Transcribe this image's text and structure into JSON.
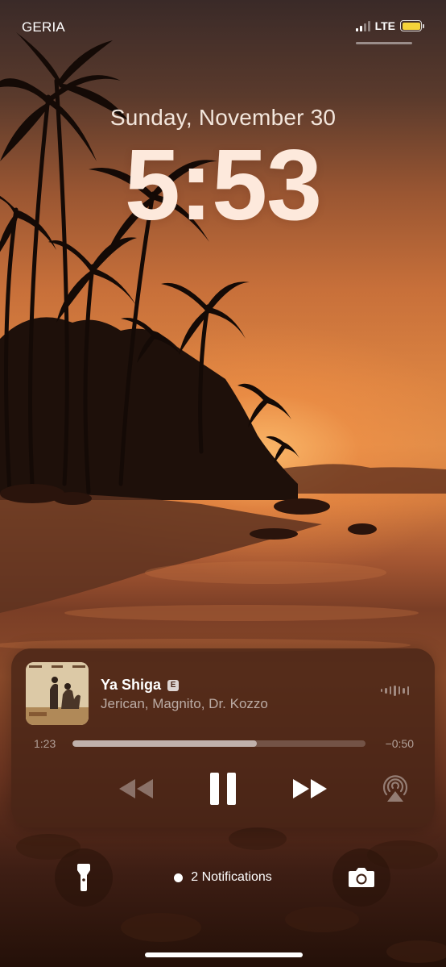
{
  "status_bar": {
    "carrier": "GERIA",
    "network": "LTE",
    "signal_bars_active": 2,
    "signal_bars_total": 4,
    "battery_color": "#f5d33a"
  },
  "lock_screen": {
    "date": "Sunday, November 30",
    "time": "5:53"
  },
  "now_playing": {
    "title": "Ya Shiga",
    "explicit_badge": "E",
    "artist": "Jerican, Magnito, Dr. Kozzo",
    "elapsed": "1:23",
    "remaining": "−0:50",
    "progress_fraction": 0.63,
    "artwork_icon": "album-artwork",
    "controls": {
      "rewind_icon": "rewind-icon",
      "pause_icon": "pause-icon",
      "forward_icon": "fast-forward-icon",
      "airplay_icon": "airplay-icon"
    }
  },
  "bottom": {
    "notifications": "2 Notifications",
    "flashlight_icon": "flashlight-icon",
    "camera_icon": "camera-icon"
  }
}
